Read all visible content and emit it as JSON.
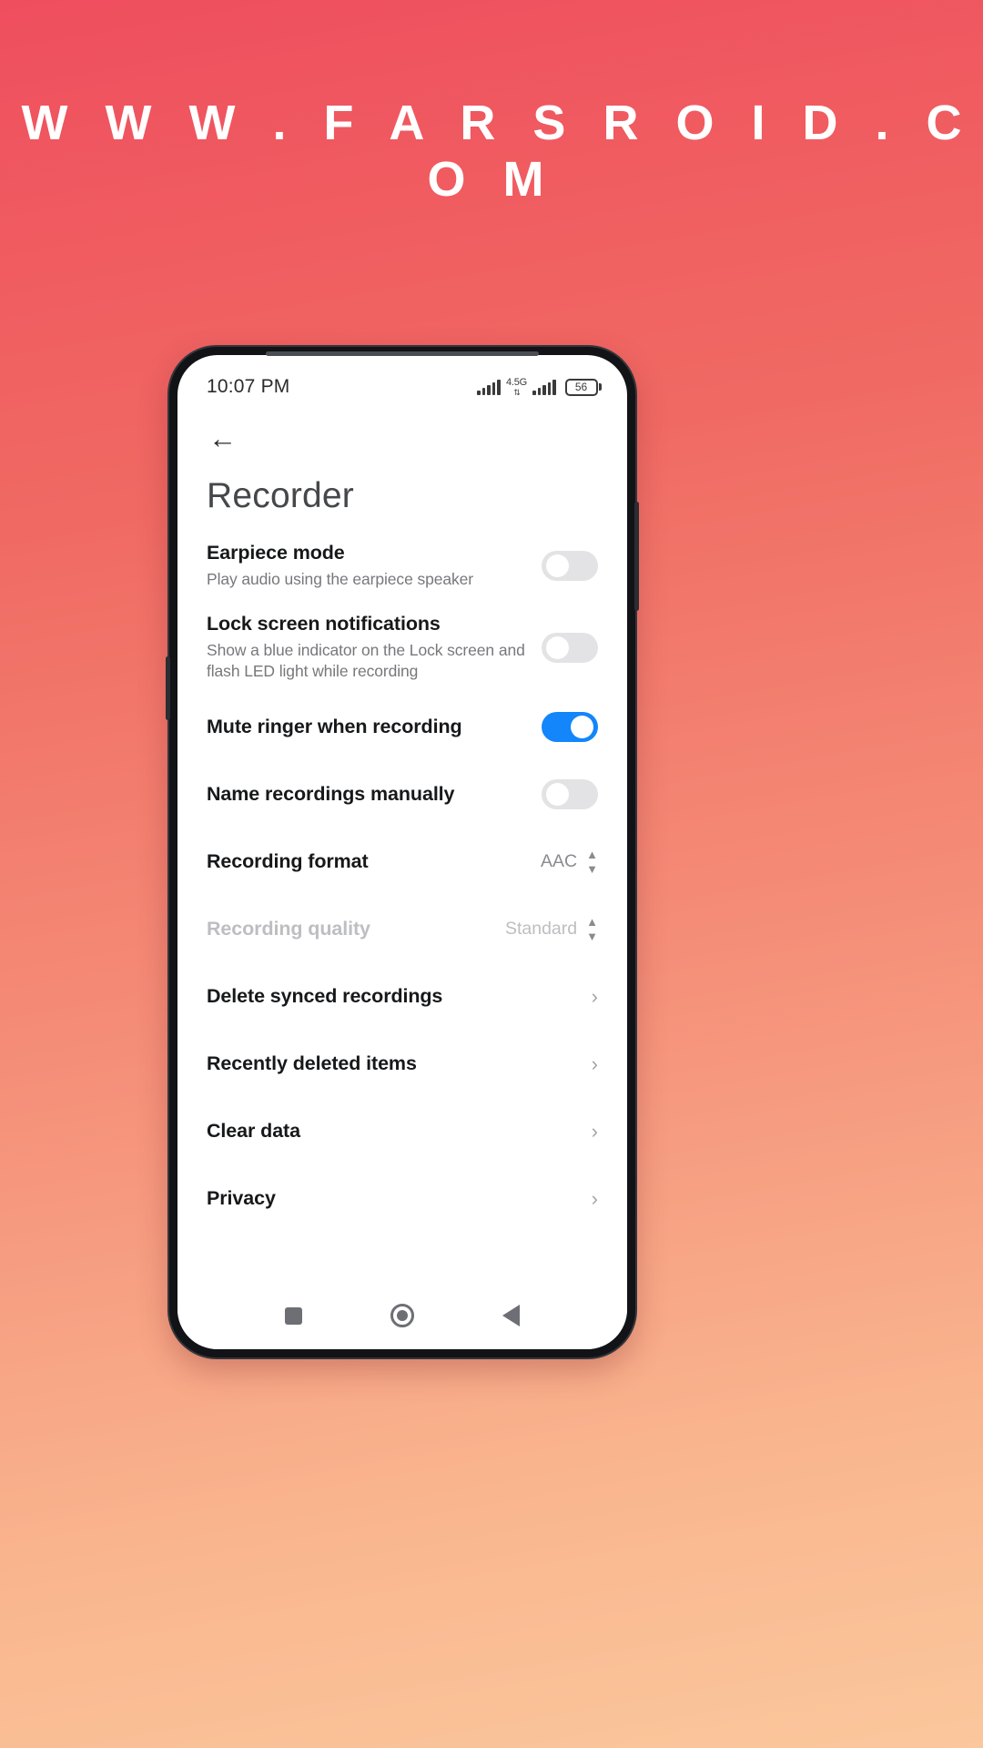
{
  "watermark": "W W W . F A R S R O I D . C O M",
  "statusbar": {
    "time": "10:07 PM",
    "network_label": "4.5G",
    "data_arrows": "⇅",
    "battery_level": "56"
  },
  "header": {
    "back_icon": "←",
    "title": "Recorder"
  },
  "settings": [
    {
      "name": "earpiece-mode",
      "title": "Earpiece mode",
      "subtitle": "Play audio using the earpiece speaker",
      "control": "toggle",
      "value": "off"
    },
    {
      "name": "lock-screen-notifications",
      "title": "Lock screen notifications",
      "subtitle": "Show a blue indicator on the Lock screen and flash LED light while recording",
      "control": "toggle",
      "value": "off"
    },
    {
      "name": "mute-ringer-when-recording",
      "title": "Mute ringer when recording",
      "subtitle": "",
      "control": "toggle",
      "value": "on"
    },
    {
      "name": "name-recordings-manually",
      "title": "Name recordings manually",
      "subtitle": "",
      "control": "toggle",
      "value": "off"
    },
    {
      "name": "recording-format",
      "title": "Recording format",
      "subtitle": "",
      "control": "stepper",
      "value": "AAC",
      "disabled": false
    },
    {
      "name": "recording-quality",
      "title": "Recording quality",
      "subtitle": "",
      "control": "stepper",
      "value": "Standard",
      "disabled": true
    },
    {
      "name": "delete-synced-recordings",
      "title": "Delete synced recordings",
      "subtitle": "",
      "control": "chevron",
      "value": ""
    },
    {
      "name": "recently-deleted-items",
      "title": "Recently deleted items",
      "subtitle": "",
      "control": "chevron",
      "value": ""
    },
    {
      "name": "clear-data",
      "title": "Clear data",
      "subtitle": "",
      "control": "chevron",
      "value": ""
    },
    {
      "name": "privacy",
      "title": "Privacy",
      "subtitle": "",
      "control": "chevron",
      "value": ""
    }
  ],
  "navbar": {
    "recents": "recents",
    "home": "home",
    "back": "back"
  },
  "colors": {
    "accent_on": "#1286fa",
    "toggle_off": "#e3e3e5",
    "title_text": "#17181a",
    "subtitle_text": "#77787c",
    "disabled_text": "#bdbec1"
  }
}
